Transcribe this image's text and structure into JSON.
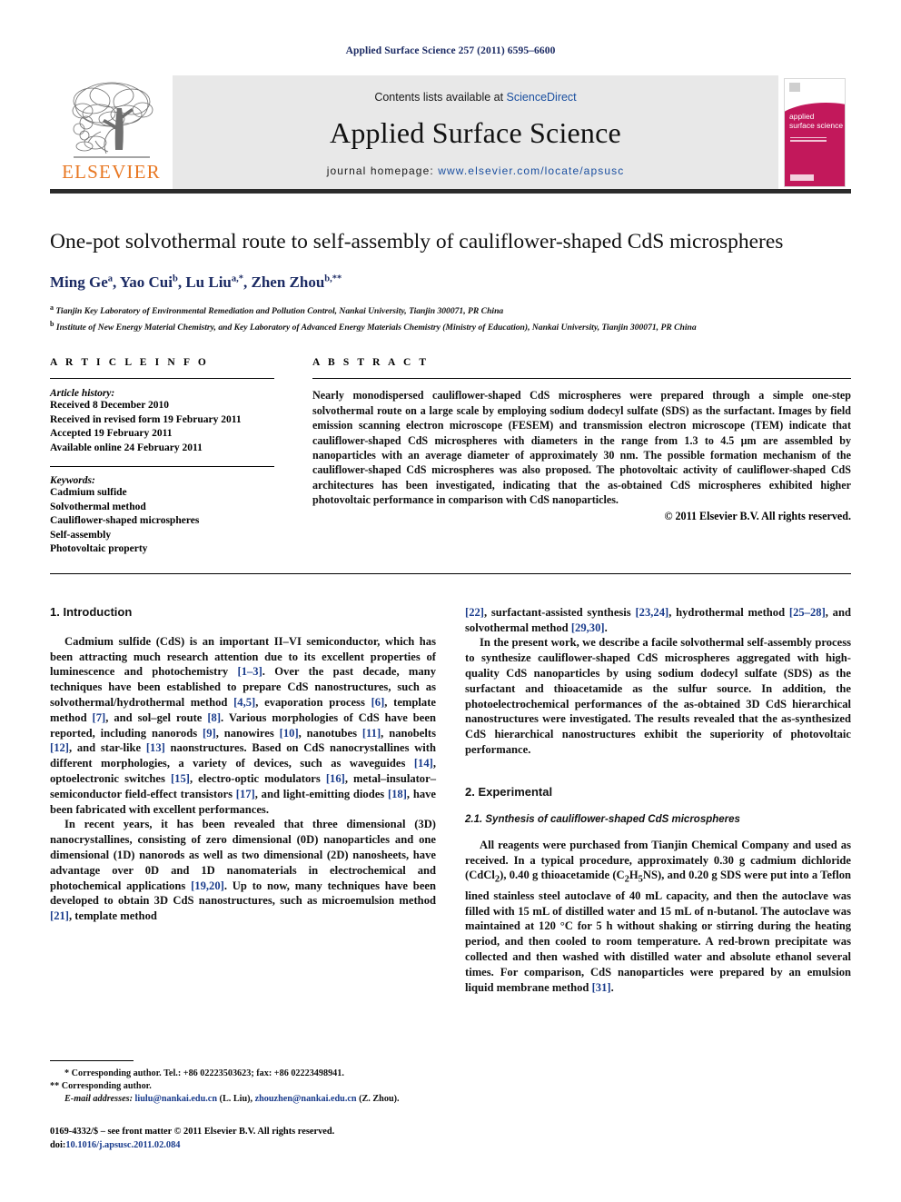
{
  "running_head": "Applied Surface Science 257 (2011) 6595–6600",
  "masthead": {
    "publisher_logo_text": "ELSEVIER",
    "contents_prefix": "Contents lists available at ",
    "contents_link": "ScienceDirect",
    "journal_title": "Applied Surface Science",
    "homepage_label": "journal homepage: ",
    "homepage_url": "www.elsevier.com/locate/apsusc",
    "cover_title_line1": "applied",
    "cover_title_line2": "surface science",
    "cover_accent_color": "#c2185b",
    "logo_color": "#e87722",
    "link_color": "#1a4fa0"
  },
  "article": {
    "title": "One-pot solvothermal route to self-assembly of cauliflower-shaped CdS microspheres",
    "authors_html": "Ming Ge<sup>a</sup>, Yao Cui<sup>b</sup>, Lu Liu<sup>a,*</sup>, Zhen Zhou<sup>b,**</sup>",
    "affiliations": [
      "a Tianjin Key Laboratory of Environmental Remediation and Pollution Control, Nankai University, Tianjin 300071, PR China",
      "b Institute of New Energy Material Chemistry, and Key Laboratory of Advanced Energy Materials Chemistry (Ministry of Education), Nankai University, Tianjin 300071, PR China"
    ]
  },
  "article_info": {
    "heading": "A R T I C L E   I N F O",
    "history_label": "Article history:",
    "history": [
      "Received 8 December 2010",
      "Received in revised form 19 February 2011",
      "Accepted 19 February 2011",
      "Available online 24 February 2011"
    ],
    "keywords_label": "Keywords:",
    "keywords": [
      "Cadmium sulfide",
      "Solvothermal method",
      "Cauliflower-shaped microspheres",
      "Self-assembly",
      "Photovoltaic property"
    ]
  },
  "abstract": {
    "heading": "A B S T R A C T",
    "text": "Nearly monodispersed cauliflower-shaped CdS microspheres were prepared through a simple one-step solvothermal route on a large scale by employing sodium dodecyl sulfate (SDS) as the surfactant. Images by field emission scanning electron microscope (FESEM) and transmission electron microscope (TEM) indicate that cauliflower-shaped CdS microspheres with diameters in the range from 1.3 to 4.5 μm are assembled by nanoparticles with an average diameter of approximately 30 nm. The possible formation mechanism of the cauliflower-shaped CdS microspheres was also proposed. The photovoltaic activity of cauliflower-shaped CdS architectures has been investigated, indicating that the as-obtained CdS microspheres exhibited higher photovoltaic performance in comparison with CdS nanoparticles.",
    "copyright": "© 2011 Elsevier B.V. All rights reserved."
  },
  "sections": {
    "intro_heading": "1.  Introduction",
    "intro_p1_html": "Cadmium sulfide (CdS) is an important II–VI semiconductor, which has been attracting much research attention due to its excellent properties of luminescence and photochemistry <span class=\"ref\">[1–3]</span>. Over the past decade, many techniques have been established to prepare CdS nanostructures, such as solvothermal/hydrothermal method <span class=\"ref\">[4,5]</span>, evaporation process <span class=\"ref\">[6]</span>, template method <span class=\"ref\">[7]</span>, and sol–gel route <span class=\"ref\">[8]</span>. Various morphologies of CdS have been reported, including nanorods <span class=\"ref\">[9]</span>, nanowires <span class=\"ref\">[10]</span>, nanotubes <span class=\"ref\">[11]</span>, nanobelts <span class=\"ref\">[12]</span>, and star-like <span class=\"ref\">[13]</span> naonstructures. Based on CdS nanocrystallines with different morphologies, a variety of devices, such as waveguides <span class=\"ref\">[14]</span>, optoelectronic switches <span class=\"ref\">[15]</span>, electro-optic modulators <span class=\"ref\">[16]</span>, metal–insulator–semiconductor field-effect transistors <span class=\"ref\">[17]</span>, and light-emitting diodes <span class=\"ref\">[18]</span>, have been fabricated with excellent performances.",
    "intro_p2_html": "In recent years, it has been revealed that three dimensional (3D) nanocrystallines, consisting of zero dimensional (0D) nanoparticles and one dimensional (1D) nanorods as well as two dimensional (2D) nanosheets, have advantage over 0D and 1D nanomaterials in electrochemical and photochemical applications <span class=\"ref\">[19,20]</span>. Up to now, many techniques have been developed to obtain 3D CdS nanostructures, such as microemulsion method <span class=\"ref\">[21]</span>, template method",
    "intro_p2_cont_html": "<span class=\"ref\">[22]</span>, surfactant-assisted synthesis <span class=\"ref\">[23,24]</span>, hydrothermal method <span class=\"ref\">[25–28]</span>, and solvothermal method <span class=\"ref\">[29,30]</span>.",
    "intro_p3_html": "In the present work, we describe a facile solvothermal self-assembly process to synthesize cauliflower-shaped CdS microspheres aggregated with high-quality CdS nanoparticles by using sodium dodecyl sulfate (SDS) as the surfactant and thioacetamide as the sulfur source. In addition, the photoelectrochemical performances of the as-obtained 3D CdS hierarchical nanostructures were investigated. The results revealed that the as-synthesized CdS hierarchical nanostructures exhibit the superiority of photovoltaic performance.",
    "exp_heading": "2.  Experimental",
    "exp_sub_heading": "2.1.  Synthesis of cauliflower-shaped CdS microspheres",
    "exp_p1_html": "All reagents were purchased from Tianjin Chemical Company and used as received. In a typical procedure, approximately 0.30 g cadmium dichloride (CdCl<sub>2</sub>), 0.40 g thioacetamide (C<sub>2</sub>H<sub>5</sub>NS), and 0.20 g SDS were put into a Teflon lined stainless steel autoclave of 40 mL capacity, and then the autoclave was filled with 15 mL of distilled water and 15 mL of n-butanol. The autoclave was maintained at 120 °C for 5 h without shaking or stirring during the heating period, and then cooled to room temperature. A red-brown precipitate was collected and then washed with distilled water and absolute ethanol several times. For comparison, CdS nanoparticles were prepared by an emulsion liquid membrane method <span class=\"ref\">[31]</span>."
  },
  "footnotes": {
    "corresponding1": "* Corresponding author. Tel.: +86 02223503623; fax: +86 02223498941.",
    "corresponding2": "** Corresponding author.",
    "email_label": "E-mail addresses:",
    "email1": "liulu@nankai.edu.cn",
    "email1_owner": "(L. Liu),",
    "email2": "zhouzhen@nankai.edu.cn",
    "email2_owner": "(Z. Zhou).",
    "issn_line": "0169-4332/$ – see front matter © 2011 Elsevier B.V. All rights reserved.",
    "doi_label": "doi:",
    "doi_value": "10.1016/j.apsusc.2011.02.084"
  }
}
